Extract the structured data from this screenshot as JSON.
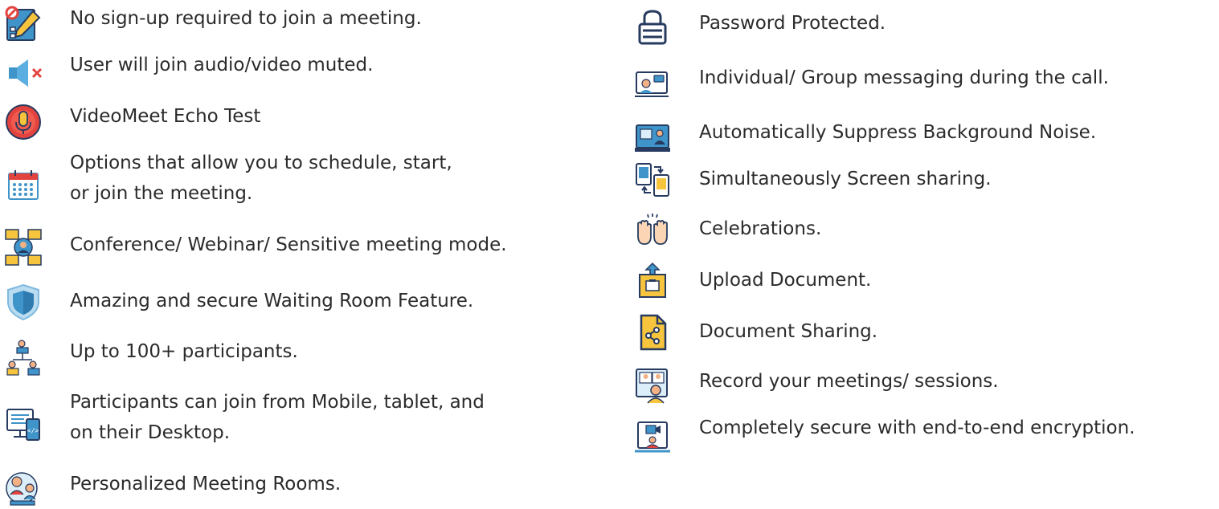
{
  "colors": {
    "text": "#2b2b2b",
    "navy": "#273a5f",
    "blue": "#3f94c9",
    "red": "#e2433e",
    "yellow": "#f6c43d",
    "orange": "#ec8a2b",
    "skin": "#f4b184"
  },
  "left_features": [
    {
      "icon": "checklist-pencil-icon",
      "lines": [
        "No sign-up required to join a meeting."
      ]
    },
    {
      "icon": "speaker-muted-icon",
      "lines": [
        "User will join audio/video muted."
      ]
    },
    {
      "icon": "microphone-icon",
      "lines": [
        "VideoMeet Echo Test"
      ]
    },
    {
      "icon": "calendar-icon",
      "lines": [
        "Options that allow you to schedule, start,",
        "or join the meeting."
      ]
    },
    {
      "icon": "conference-icon",
      "lines": [
        "Conference/ Webinar/ Sensitive meeting mode."
      ]
    },
    {
      "icon": "shield-icon",
      "lines": [
        "Amazing and secure Waiting Room Feature."
      ]
    },
    {
      "icon": "network-users-icon",
      "lines": [
        "Up to 100+ participants."
      ]
    },
    {
      "icon": "desktop-mobile-icon",
      "lines": [
        "Participants can join from Mobile, tablet, and",
        "on their Desktop."
      ]
    },
    {
      "icon": "meeting-room-icon",
      "lines": [
        "Personalized Meeting Rooms."
      ]
    }
  ],
  "right_features": [
    {
      "icon": "lock-icon",
      "lines": [
        "Password Protected."
      ]
    },
    {
      "icon": "chat-monitor-icon",
      "lines": [
        "Individual/ Group messaging during the call."
      ]
    },
    {
      "icon": "noise-suppression-icon",
      "lines": [
        "Automatically Suppress Background Noise."
      ]
    },
    {
      "icon": "screen-share-icon",
      "lines": [
        "Simultaneously Screen sharing."
      ]
    },
    {
      "icon": "clapping-hands-icon",
      "lines": [
        "Celebrations."
      ]
    },
    {
      "icon": "upload-document-icon",
      "lines": [
        "Upload Document."
      ]
    },
    {
      "icon": "share-document-icon",
      "lines": [
        "Document Sharing."
      ]
    },
    {
      "icon": "record-meeting-icon",
      "lines": [
        "Record your meetings/ sessions."
      ]
    },
    {
      "icon": "encryption-icon",
      "lines": [
        "Completely secure with end-to-end encryption."
      ]
    }
  ]
}
